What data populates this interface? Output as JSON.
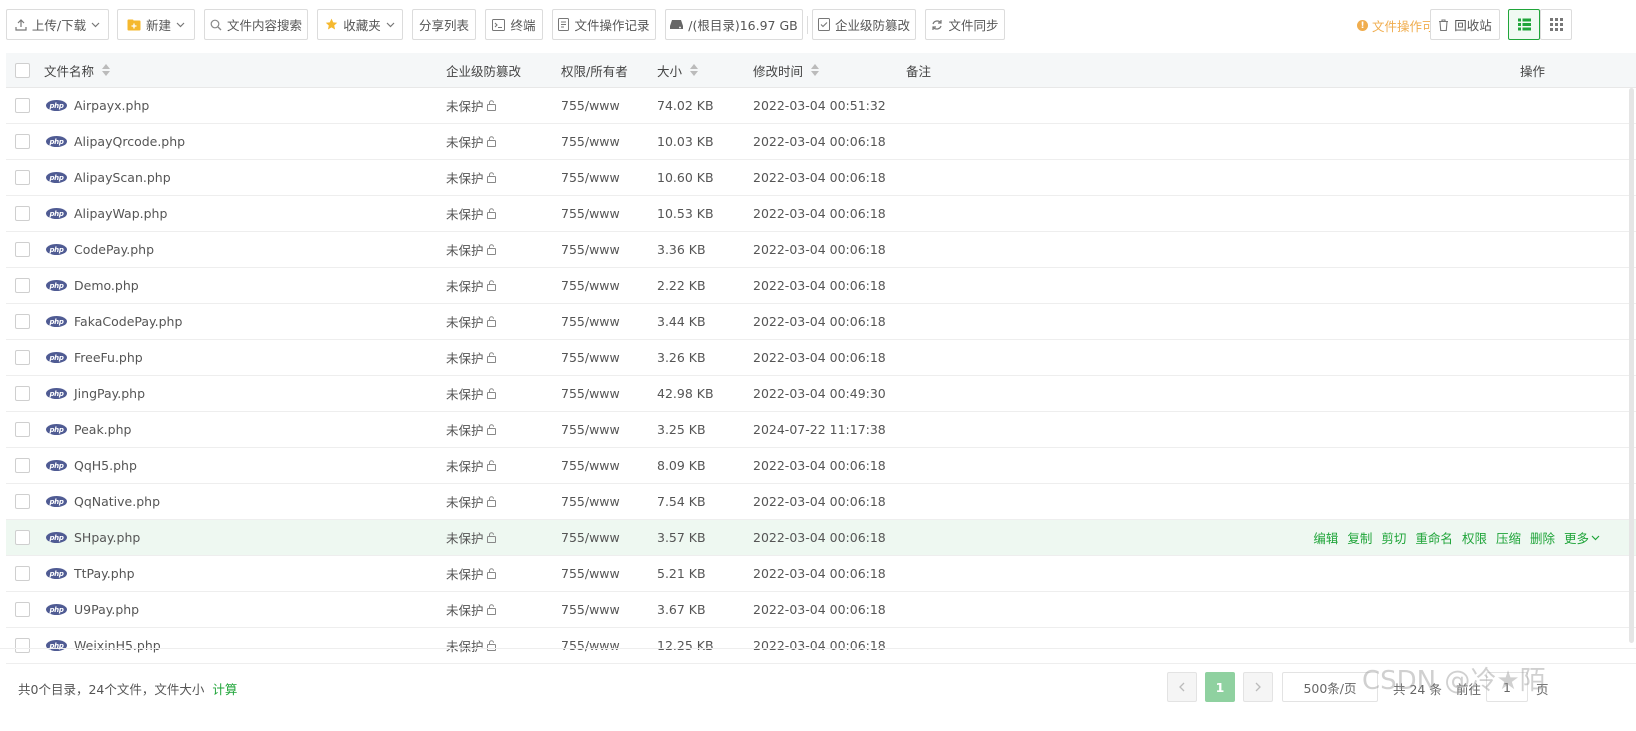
{
  "toolbar": {
    "upload": "上传/下载",
    "new": "新建",
    "content_search": "文件内容搜索",
    "favorites": "收藏夹",
    "share_list": "分享列表",
    "terminal": "终端",
    "op_log": "文件操作记录",
    "disk": "/(根目录)16.97 GB",
    "tamper": "企业级防篡改",
    "sync": "文件同步",
    "tip": "文件操作可使用右键",
    "recycle": "回收站"
  },
  "table": {
    "headers": {
      "name": "文件名称",
      "tamper": "企业级防篡改",
      "perm": "权限/所有者",
      "size": "大小",
      "mtime": "修改时间",
      "remark": "备注",
      "ops": "操作"
    },
    "rows": [
      {
        "name": "Airpayx.php",
        "tamper": "未保护",
        "perm": "755/www",
        "size": "74.02 KB",
        "mtime": "2022-03-04 00:51:32"
      },
      {
        "name": "AlipayQrcode.php",
        "tamper": "未保护",
        "perm": "755/www",
        "size": "10.03 KB",
        "mtime": "2022-03-04 00:06:18"
      },
      {
        "name": "AlipayScan.php",
        "tamper": "未保护",
        "perm": "755/www",
        "size": "10.60 KB",
        "mtime": "2022-03-04 00:06:18"
      },
      {
        "name": "AlipayWap.php",
        "tamper": "未保护",
        "perm": "755/www",
        "size": "10.53 KB",
        "mtime": "2022-03-04 00:06:18"
      },
      {
        "name": "CodePay.php",
        "tamper": "未保护",
        "perm": "755/www",
        "size": "3.36 KB",
        "mtime": "2022-03-04 00:06:18"
      },
      {
        "name": "Demo.php",
        "tamper": "未保护",
        "perm": "755/www",
        "size": "2.22 KB",
        "mtime": "2022-03-04 00:06:18"
      },
      {
        "name": "FakaCodePay.php",
        "tamper": "未保护",
        "perm": "755/www",
        "size": "3.44 KB",
        "mtime": "2022-03-04 00:06:18"
      },
      {
        "name": "FreeFu.php",
        "tamper": "未保护",
        "perm": "755/www",
        "size": "3.26 KB",
        "mtime": "2022-03-04 00:06:18"
      },
      {
        "name": "JingPay.php",
        "tamper": "未保护",
        "perm": "755/www",
        "size": "42.98 KB",
        "mtime": "2022-03-04 00:49:30"
      },
      {
        "name": "Peak.php",
        "tamper": "未保护",
        "perm": "755/www",
        "size": "3.25 KB",
        "mtime": "2024-07-22 11:17:38"
      },
      {
        "name": "QqH5.php",
        "tamper": "未保护",
        "perm": "755/www",
        "size": "8.09 KB",
        "mtime": "2022-03-04 00:06:18"
      },
      {
        "name": "QqNative.php",
        "tamper": "未保护",
        "perm": "755/www",
        "size": "7.54 KB",
        "mtime": "2022-03-04 00:06:18"
      },
      {
        "name": "SHpay.php",
        "tamper": "未保护",
        "perm": "755/www",
        "size": "3.57 KB",
        "mtime": "2022-03-04 00:06:18"
      },
      {
        "name": "TtPay.php",
        "tamper": "未保护",
        "perm": "755/www",
        "size": "5.21 KB",
        "mtime": "2022-03-04 00:06:18"
      },
      {
        "name": "U9Pay.php",
        "tamper": "未保护",
        "perm": "755/www",
        "size": "3.67 KB",
        "mtime": "2022-03-04 00:06:18"
      },
      {
        "name": "WeixinH5.php",
        "tamper": "未保护",
        "perm": "755/www",
        "size": "12.25 KB",
        "mtime": "2022-03-04 00:06:18"
      }
    ],
    "row_actions": {
      "edit": "编辑",
      "copy": "复制",
      "cut": "剪切",
      "rename": "重命名",
      "perm": "权限",
      "compress": "压缩",
      "delete": "删除",
      "more": "更多"
    }
  },
  "footer": {
    "summary": "共0个目录，24个文件，文件大小",
    "calc": "计算",
    "current_page": "1",
    "page_size": "500条/页",
    "total": "共 24 条",
    "goto": "前往",
    "goto_value": "1",
    "page_unit": "页"
  },
  "watermark": "CSDN @冷★陌",
  "colors": {
    "accent": "#20a53a",
    "warning": "#f0ad4e",
    "php_icon": "#4f5b93"
  }
}
